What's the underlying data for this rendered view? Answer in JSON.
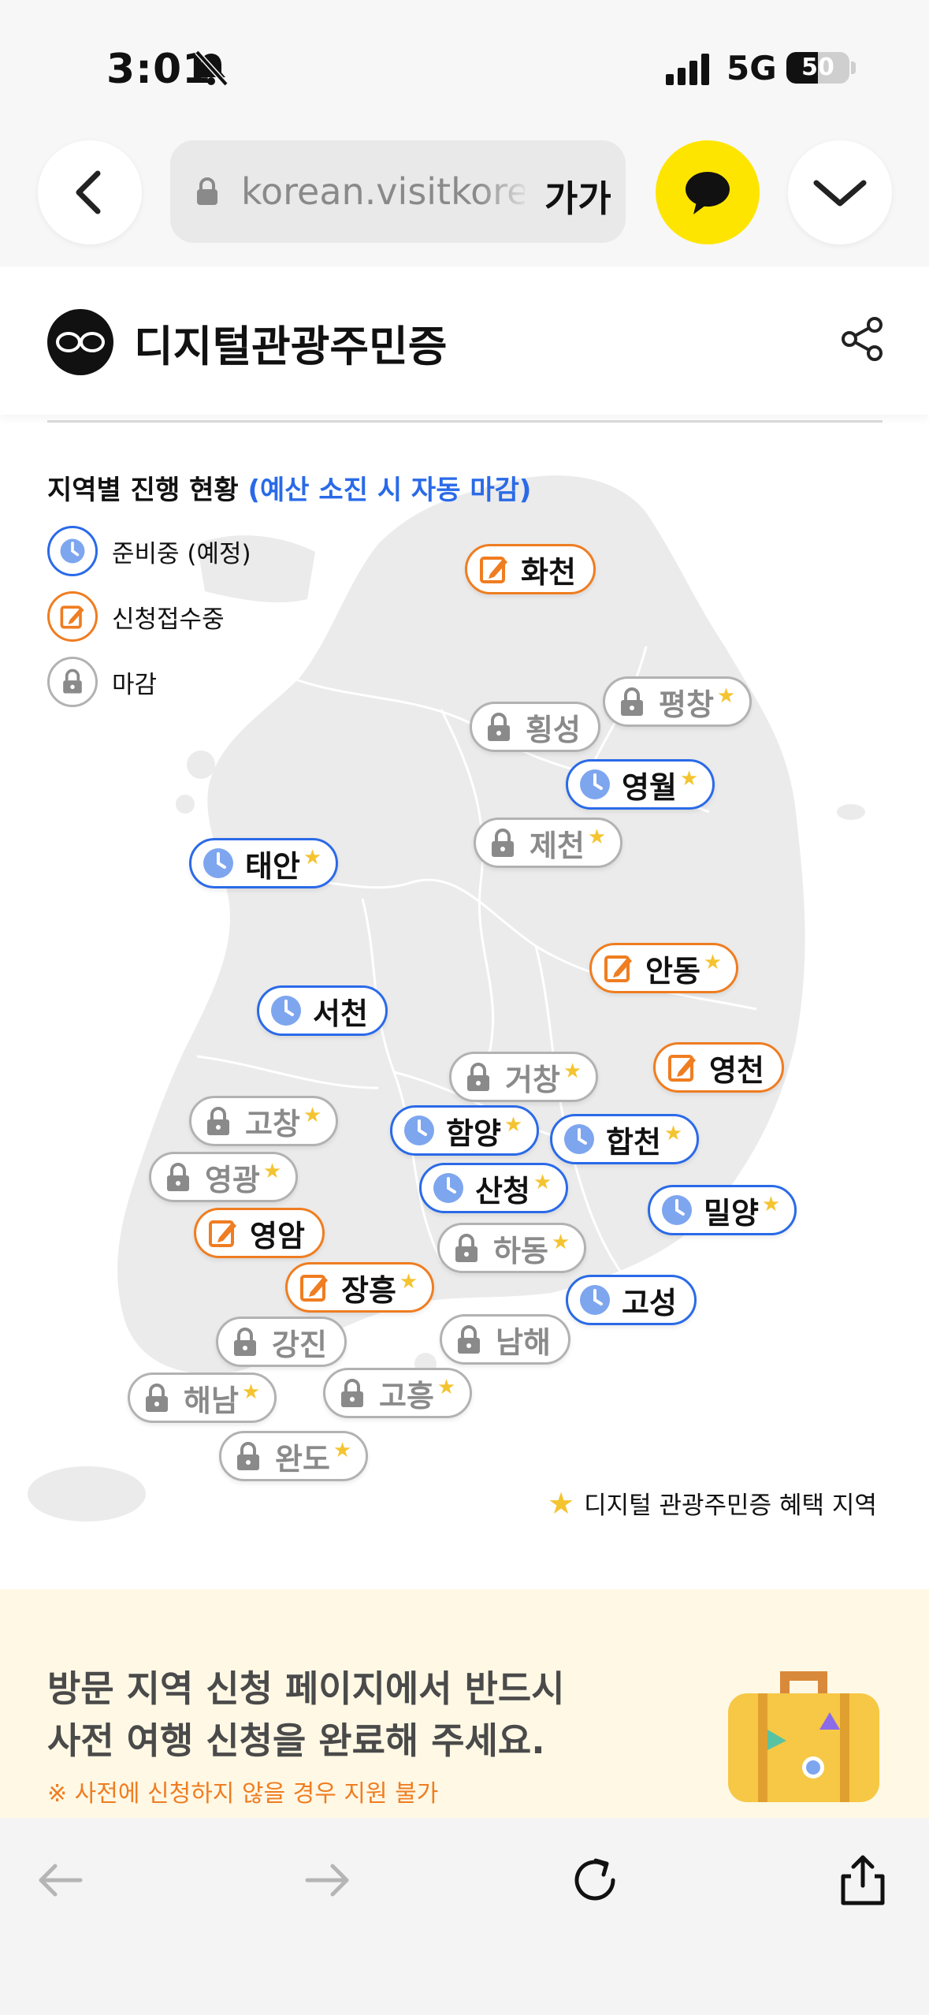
{
  "status_bar": {
    "time": "3:01",
    "network": "5G",
    "battery_level": "50",
    "battery_fraction": 0.5
  },
  "browser": {
    "url": "korean.visitkorea.or.kr",
    "text_size_label": "가가"
  },
  "site": {
    "title": "디지털관광주민증"
  },
  "map": {
    "title": "지역별 진행 현황",
    "title_note": "(예산 소진 시 자동 마감)",
    "legend": [
      {
        "label": "준비중 (예정)",
        "status": "pending"
      },
      {
        "label": "신청접수중",
        "status": "open"
      },
      {
        "label": "마감",
        "status": "closed"
      }
    ],
    "regions": [
      {
        "name": "화천",
        "status": "open",
        "star": ""
      },
      {
        "name": "평창",
        "status": "closed",
        "star": "★"
      },
      {
        "name": "횡성",
        "status": "closed",
        "star": ""
      },
      {
        "name": "영월",
        "status": "pending",
        "star": "★"
      },
      {
        "name": "제천",
        "status": "closed",
        "star": "★"
      },
      {
        "name": "태안",
        "status": "pending",
        "star": "★"
      },
      {
        "name": "안동",
        "status": "open",
        "star": "★"
      },
      {
        "name": "서천",
        "status": "pending",
        "star": ""
      },
      {
        "name": "영천",
        "status": "open",
        "star": ""
      },
      {
        "name": "거창",
        "status": "closed",
        "star": "★"
      },
      {
        "name": "고창",
        "status": "closed",
        "star": "★"
      },
      {
        "name": "함양",
        "status": "pending",
        "star": "★"
      },
      {
        "name": "합천",
        "status": "pending",
        "star": "★"
      },
      {
        "name": "영광",
        "status": "closed",
        "star": "★"
      },
      {
        "name": "산청",
        "status": "pending",
        "star": "★"
      },
      {
        "name": "밀양",
        "status": "pending",
        "star": "★"
      },
      {
        "name": "영암",
        "status": "open",
        "star": ""
      },
      {
        "name": "하동",
        "status": "closed",
        "star": "★"
      },
      {
        "name": "장흥",
        "status": "open",
        "star": "★"
      },
      {
        "name": "고성",
        "status": "pending",
        "star": ""
      },
      {
        "name": "강진",
        "status": "closed",
        "star": ""
      },
      {
        "name": "남해",
        "status": "closed",
        "star": ""
      },
      {
        "name": "해남",
        "status": "closed",
        "star": "★"
      },
      {
        "name": "고흥",
        "status": "closed",
        "star": "★"
      },
      {
        "name": "완도",
        "status": "closed",
        "star": "★"
      }
    ],
    "benefit_star": "★",
    "benefit_label": "디지털 관광주민증 혜택 지역"
  },
  "notice": {
    "line1": "방문 지역 신청 페이지에서 반드시",
    "line2": "사전 여행 신청을 완료해 주세요.",
    "note": "※ 사전에 신청하지 않을 경우 지원 불가"
  },
  "colors": {
    "pending": "#2a6ae8",
    "open": "#ef7d21",
    "closed": "#b2b2b2",
    "star": "#f4c430",
    "kakao": "#fee500",
    "notice_bg": "#fff8e5"
  },
  "icons": {
    "pending": "clock-icon",
    "open": "edit-icon",
    "closed": "lock-icon",
    "nav": [
      "back-arrow-icon",
      "forward-arrow-icon",
      "reload-icon",
      "share-upload-icon"
    ]
  }
}
